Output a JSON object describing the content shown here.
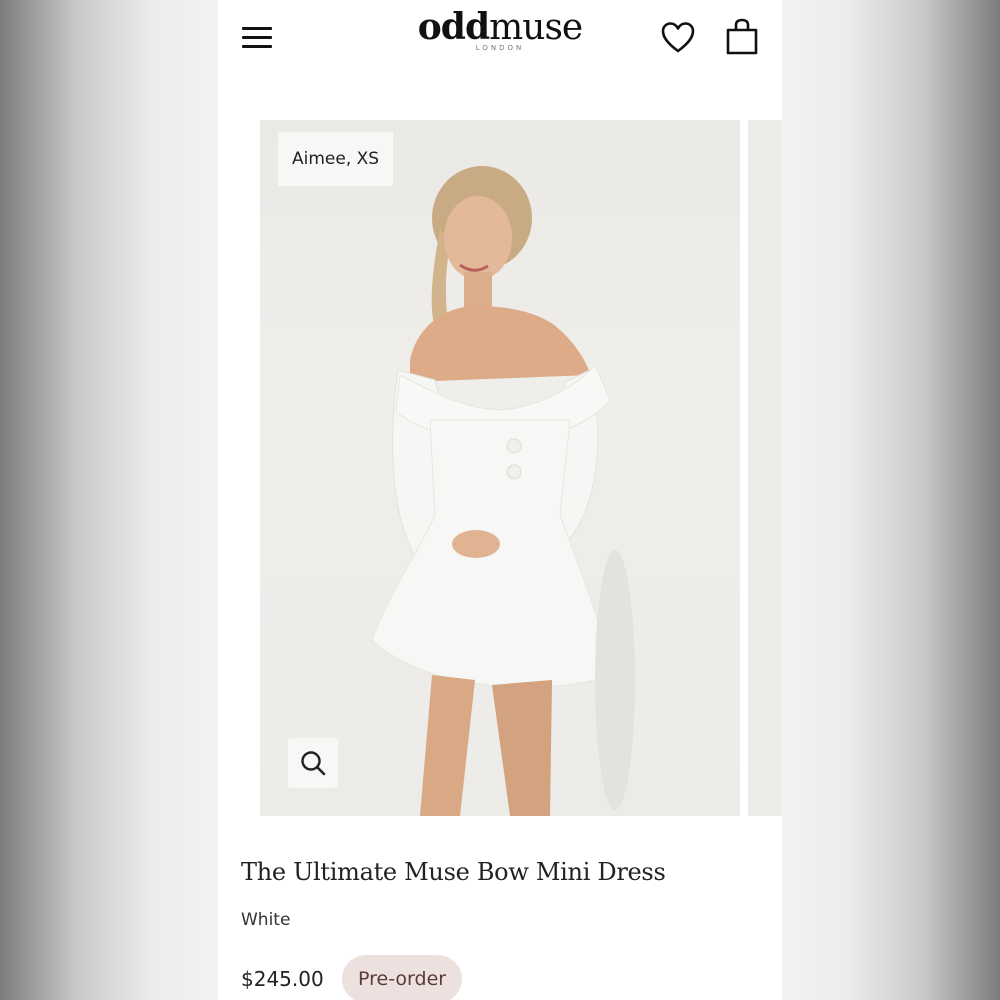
{
  "header": {
    "logo_main": "oddmuse",
    "logo_sub": "LONDON",
    "icons": [
      "menu-icon",
      "heart-icon",
      "bag-icon"
    ]
  },
  "gallery": {
    "model_label": "Aimee, XS",
    "zoom_icon": "search-icon"
  },
  "product": {
    "title": "The Ultimate Muse Bow Mini Dress",
    "color": "White",
    "price": "$245.00",
    "badge": "Pre-order"
  },
  "colors": {
    "badge_bg": "#ece1de",
    "text": "#222222"
  }
}
